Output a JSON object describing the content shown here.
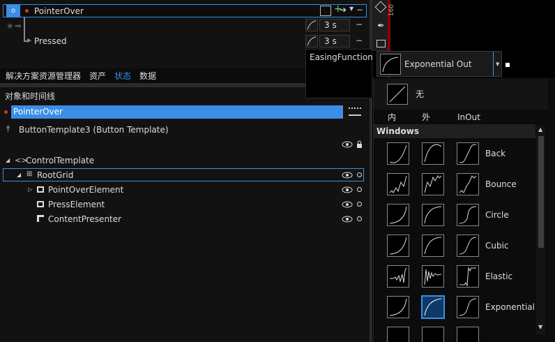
{
  "states": {
    "state_name": "PointerOver",
    "state_o": "o",
    "transition_target": "Pressed",
    "durations": [
      "3 s",
      "3 s"
    ],
    "minus": "−"
  },
  "tabs": [
    "解决方案资源管理器",
    "资产",
    "状态",
    "数据"
  ],
  "objects": {
    "title": "对象和时间线",
    "current_state": "PointerOver",
    "template_scope": "ButtonTemplate3 (Button Template)",
    "tree": [
      {
        "label": "ControlTemplate"
      },
      {
        "label": "RootGrid"
      },
      {
        "label": "PointOverElement"
      },
      {
        "label": "PressElement"
      },
      {
        "label": "ContentPresenter"
      }
    ]
  },
  "easing": {
    "label": "EasingFunction",
    "selected": "Exponential Out",
    "none_label": "无",
    "categories": [
      "内",
      "外",
      "InOut"
    ],
    "group": "Windows",
    "families": [
      "Back",
      "Bounce",
      "Circle",
      "Cubic",
      "Elastic",
      "Exponential"
    ]
  },
  "ruler": {
    "mark": "160"
  },
  "colors": {
    "accent": "#3a8ee6",
    "recording": "#e03030",
    "ruler": "#8b0000"
  }
}
